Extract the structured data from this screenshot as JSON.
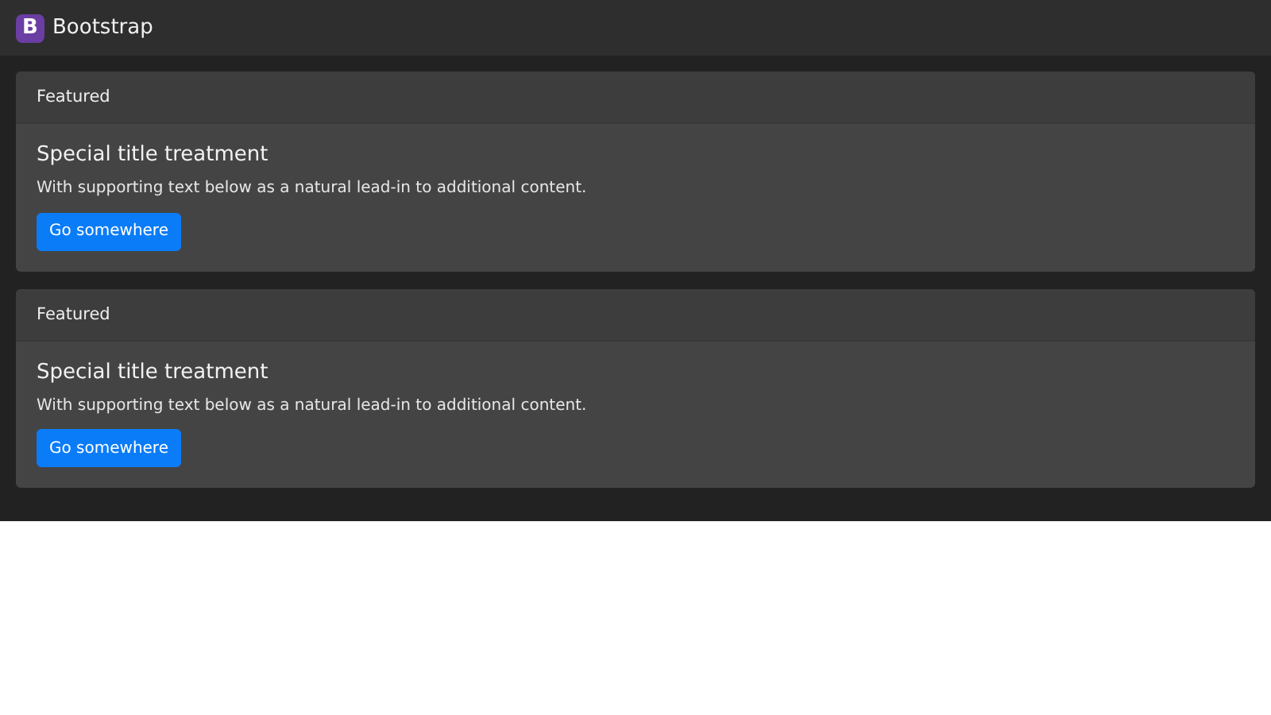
{
  "navbar": {
    "logo_letter": "B",
    "brand": "Bootstrap"
  },
  "cards": [
    {
      "header": "Featured",
      "title": "Special title treatment",
      "text": "With supporting text below as a natural lead-in to additional content.",
      "button": "Go somewhere"
    },
    {
      "header": "Featured",
      "title": "Special title treatment",
      "text": "With supporting text below as a natural lead-in to additional content.",
      "button": "Go somewhere"
    }
  ]
}
